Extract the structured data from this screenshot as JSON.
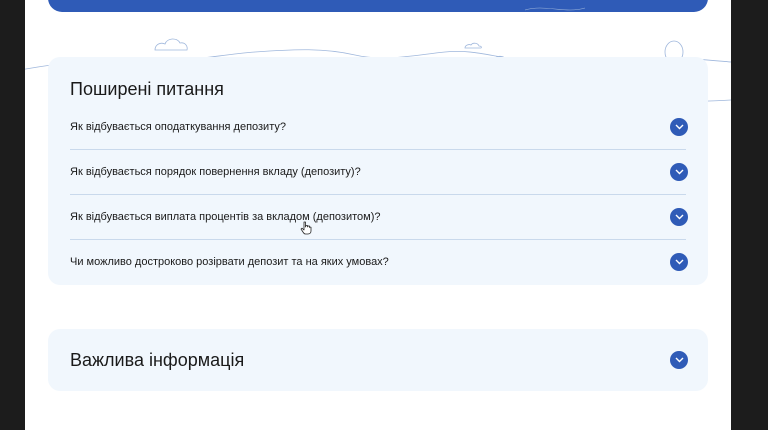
{
  "faq": {
    "title": "Поширені питання",
    "items": [
      {
        "question": "Як відбувається оподаткування депозиту?",
        "icon": "chevron-down-icon"
      },
      {
        "question": "Як відбувається порядок повернення вкладу (депозиту)?",
        "icon": "chevron-down-icon"
      },
      {
        "question": "Як відбувається виплата процентів за вкладом (депозитом)?",
        "icon": "chevron-down-icon"
      },
      {
        "question": "Чи можливо достроково розірвати депозит та на яких умовах?",
        "icon": "chevron-down-icon"
      }
    ]
  },
  "info": {
    "title": "Важлива інформація",
    "icon": "chevron-down-icon"
  },
  "colors": {
    "accent": "#2f5bb7",
    "card_bg": "#f1f7fd",
    "divider": "#c9d9ec",
    "text": "#1a1a1a"
  }
}
